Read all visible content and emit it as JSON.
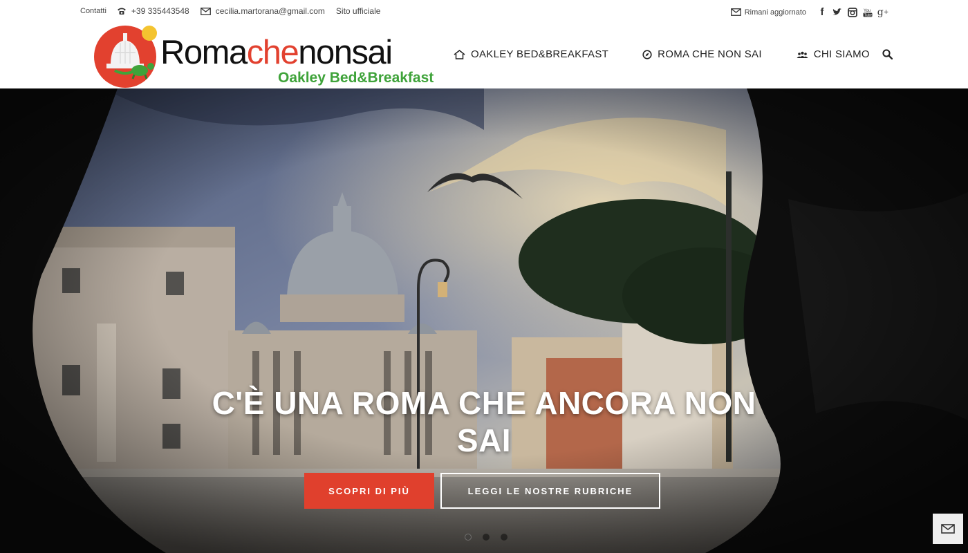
{
  "topbar": {
    "contacts_label": "Contatti",
    "phone": "+39 335443548",
    "email": "cecilia.martorana@gmail.com",
    "official_site": "Sito ufficiale",
    "newsletter": "Rimani aggiornato",
    "social": [
      {
        "icon": "facebook-icon",
        "glyph": "f"
      },
      {
        "icon": "twitter-icon",
        "glyph": "t"
      },
      {
        "icon": "instagram-icon",
        "glyph": "ig"
      },
      {
        "icon": "youtube-icon",
        "glyph": "You Tube"
      },
      {
        "icon": "google-plus-icon",
        "glyph": "g+"
      }
    ]
  },
  "logo": {
    "part1": "Roma",
    "part2": "che",
    "part3": "nonsai",
    "subtitle": "Oakley Bed&Breakfast"
  },
  "nav": {
    "items": [
      {
        "label": "OAKLEY BED&BREAKFAST",
        "icon": "home-icon"
      },
      {
        "label": "ROMA CHE NON SAI",
        "icon": "compass-icon"
      },
      {
        "label": "CHI SIAMO",
        "icon": "people-icon"
      }
    ],
    "search_icon": "search-icon"
  },
  "hero": {
    "title": "C'È UNA ROMA CHE ANCORA NON SAI",
    "primary_button": "SCOPRI DI PIÙ",
    "secondary_button": "LEGGI LE NOSTRE RUBRICHE",
    "slides": 3,
    "active_slide": 1
  },
  "colors": {
    "accent": "#e0402d",
    "logo_green": "#3fa33a",
    "logo_red": "#e2412f"
  }
}
